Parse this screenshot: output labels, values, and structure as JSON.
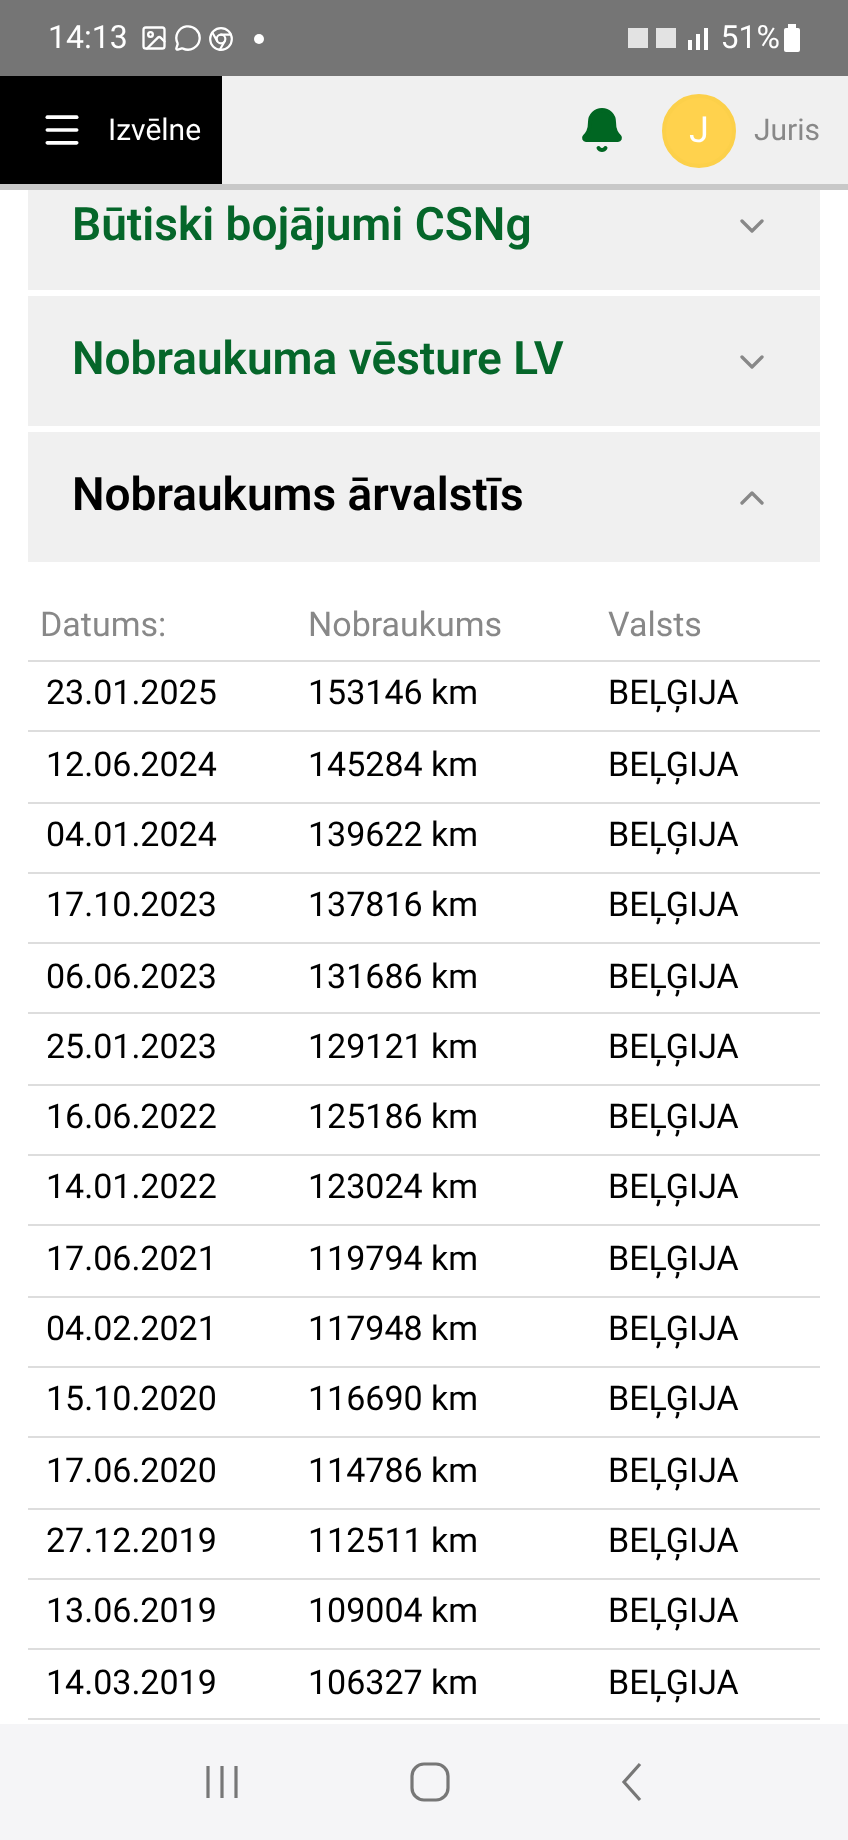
{
  "status_bar": {
    "time": "14:13",
    "battery": "51%"
  },
  "header": {
    "menu_label": "Izvēlne",
    "user_initial": "J",
    "user_name": "Juris"
  },
  "sections": [
    {
      "title": "Būtiski bojājumi CSNg",
      "expanded": false
    },
    {
      "title": "Nobraukuma vēsture LV",
      "expanded": false
    },
    {
      "title": "Nobraukums ārvalstīs",
      "expanded": true
    }
  ],
  "table": {
    "columns": [
      "Datums:",
      "Nobraukums",
      "Valsts"
    ],
    "rows": [
      [
        "23.01.2025",
        "153146 km",
        "BEĻĢIJA"
      ],
      [
        "12.06.2024",
        "145284 km",
        "BEĻĢIJA"
      ],
      [
        "04.01.2024",
        "139622 km",
        "BEĻĢIJA"
      ],
      [
        "17.10.2023",
        "137816 km",
        "BEĻĢIJA"
      ],
      [
        "06.06.2023",
        "131686 km",
        "BEĻĢIJA"
      ],
      [
        "25.01.2023",
        "129121 km",
        "BEĻĢIJA"
      ],
      [
        "16.06.2022",
        "125186 km",
        "BEĻĢIJA"
      ],
      [
        "14.01.2022",
        "123024 km",
        "BEĻĢIJA"
      ],
      [
        "17.06.2021",
        "119794 km",
        "BEĻĢIJA"
      ],
      [
        "04.02.2021",
        "117948 km",
        "BEĻĢIJA"
      ],
      [
        "15.10.2020",
        "116690 km",
        "BEĻĢIJA"
      ],
      [
        "17.06.2020",
        "114786 km",
        "BEĻĢIJA"
      ],
      [
        "27.12.2019",
        "112511 km",
        "BEĻĢIJA"
      ],
      [
        "13.06.2019",
        "109004 km",
        "BEĻĢIJA"
      ],
      [
        "14.03.2019",
        "106327 km",
        "BEĻĢIJA"
      ]
    ]
  }
}
